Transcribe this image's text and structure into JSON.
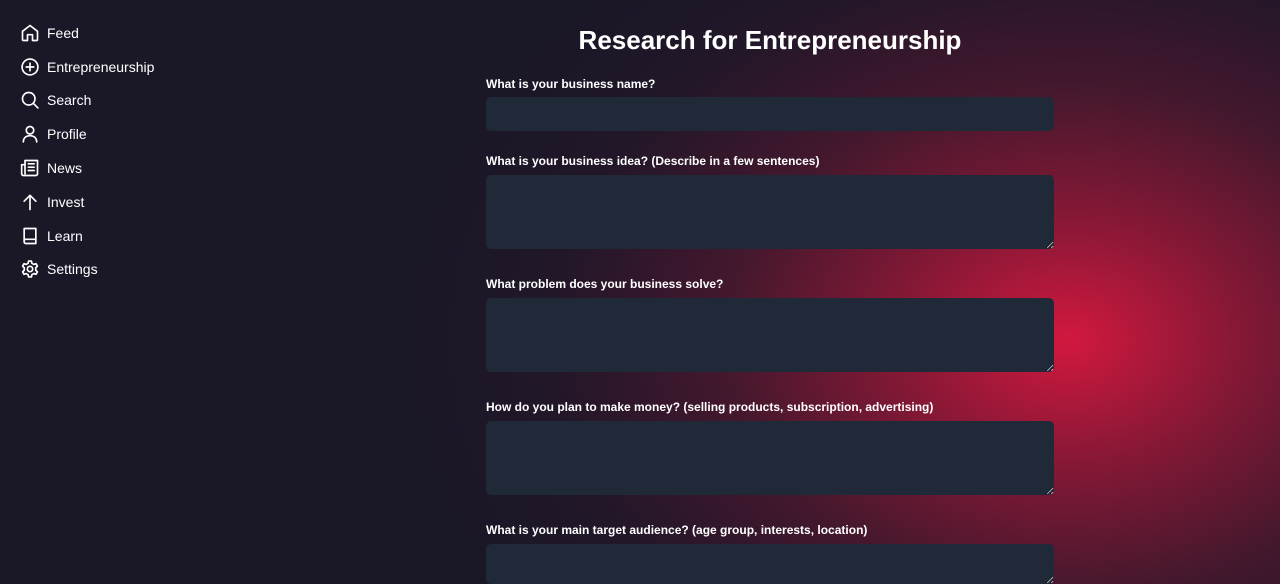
{
  "sidebar": {
    "items": [
      {
        "label": "Feed",
        "icon": "home-icon"
      },
      {
        "label": "Entrepreneurship",
        "icon": "plus-circle-icon"
      },
      {
        "label": "Search",
        "icon": "search-icon"
      },
      {
        "label": "Profile",
        "icon": "user-icon"
      },
      {
        "label": "News",
        "icon": "newspaper-icon"
      },
      {
        "label": "Invest",
        "icon": "arrow-up-icon"
      },
      {
        "label": "Learn",
        "icon": "book-icon"
      },
      {
        "label": "Settings",
        "icon": "gear-icon"
      }
    ]
  },
  "main": {
    "title": "Research for Entrepreneurship",
    "questions": [
      {
        "label": "What is your business name?",
        "value": ""
      },
      {
        "label": "What is your business idea? (Describe in a few sentences)",
        "value": ""
      },
      {
        "label": "What problem does your business solve?",
        "value": ""
      },
      {
        "label": "How do you plan to make money? (selling products, subscription, advertising)",
        "value": ""
      },
      {
        "label": "What is your main target audience? (age group, interests, location)",
        "value": ""
      }
    ]
  },
  "colors": {
    "background": "#1a1727",
    "accent_glow": "#dc1840",
    "field_background": "#1f2937",
    "text": "#ffffff"
  }
}
